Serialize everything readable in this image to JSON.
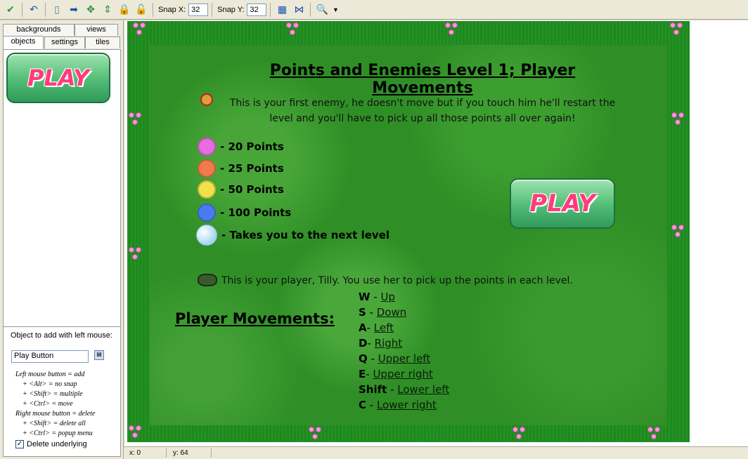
{
  "toolbar": {
    "snap_x_label": "Snap X:",
    "snap_x_value": "32",
    "snap_y_label": "Snap Y:",
    "snap_y_value": "32",
    "icons": [
      "check-icon",
      "undo-icon",
      "new-icon",
      "arrow-right-icon",
      "move-icon",
      "shift-icon",
      "lock-icon",
      "unlock-icon",
      "grid-icon",
      "iso-grid-icon",
      "zoom-icon",
      "dropdown-icon"
    ]
  },
  "tabs": {
    "backgrounds": "backgrounds",
    "views": "views",
    "objects": "objects",
    "settings": "settings",
    "tiles": "tiles"
  },
  "object_panel": {
    "thumb_label": "PLAY",
    "add_label": "Object to add with left mouse:",
    "selected_object": "Play Button",
    "help": [
      "Left mouse button = add",
      "+ <Alt> = no snap",
      "+ <Shift> = multiple",
      "+ <Ctrl> = move",
      "Right mouse button = delete",
      "+ <Shift> = delete all",
      "+ <Ctrl> = popup menu"
    ],
    "delete_underlying_label": "Delete underlying"
  },
  "status": {
    "x": "x: 0",
    "y": "y: 64"
  },
  "room": {
    "title": "Points and Enemies Level 1; Player Movements",
    "enemy_text": "This is your first enemy, he doesn't move but if you touch him he'll restart the level and you'll have to pick up all those points all over again!",
    "points": [
      {
        "label": "- 20 Points",
        "color": "#e86be0"
      },
      {
        "label": "- 25 Points",
        "color": "#f07a4a"
      },
      {
        "label": "- 50 Points",
        "color": "#f2e04a"
      },
      {
        "label": "- 100 Points",
        "color": "#4a7af0"
      },
      {
        "label": "- Takes you to the next level",
        "color": "#bfe5f5"
      }
    ],
    "play_label": "PLAY",
    "player_text": "This is your player, Tilly. You use her to pick up the points in each level.",
    "movements_heading": "Player Movements:",
    "movements": [
      {
        "key": "W",
        "sep": " - ",
        "action": "Up"
      },
      {
        "key": "S",
        "sep": " - ",
        "action": "Down"
      },
      {
        "key": "A",
        "sep": "- ",
        "action": "Left"
      },
      {
        "key": "D",
        "sep": "- ",
        "action": "Right"
      },
      {
        "key": "Q",
        "sep": " - ",
        "action": "Upper left"
      },
      {
        "key": "E",
        "sep": "- ",
        "action": "Upper right"
      },
      {
        "key": "Shift",
        "sep": " - ",
        "action": "Lower left"
      },
      {
        "key": "C",
        "sep": " - ",
        "action": "Lower right"
      }
    ]
  }
}
